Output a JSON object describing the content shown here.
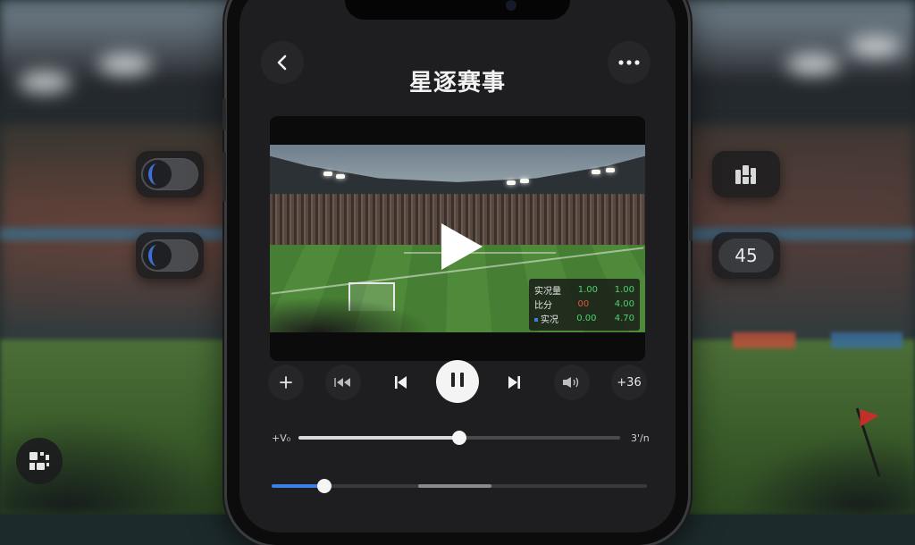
{
  "app": {
    "title": "星逐赛事"
  },
  "header": {
    "back_icon": "chevron-left-icon",
    "more_icon": "more-horizontal-icon"
  },
  "side_controls": {
    "left_toggle_1": {
      "state": "on",
      "accent": "#3f6fd6"
    },
    "left_toggle_2": {
      "state": "on",
      "accent": "#3f6fd6"
    },
    "right_icon": "bar-chart-icon",
    "right_counter": "45"
  },
  "video": {
    "play_icon": "play-icon",
    "stats_overlay": [
      {
        "label": "实况量",
        "v1": "1.00",
        "v2": "1.00"
      },
      {
        "label": "比分",
        "v1": "00",
        "v2": "4.00"
      },
      {
        "label": "实况",
        "v1": "0.00",
        "v2": "4.70"
      }
    ]
  },
  "controls": {
    "add_icon": "plus-icon",
    "rewind_icon": "rewind-icon",
    "previous_icon": "skip-previous-icon",
    "pause_icon": "pause-icon",
    "next_icon": "skip-next-icon",
    "volume_icon": "volume-icon",
    "forward_label": "+36"
  },
  "seek": {
    "left_label": "+V₀",
    "right_label": "3'/n",
    "progress": 0.5
  },
  "secondary_slider": {
    "progress": 0.14,
    "accent": "#3b82e8"
  },
  "corner": {
    "icon": "grid-icon"
  }
}
